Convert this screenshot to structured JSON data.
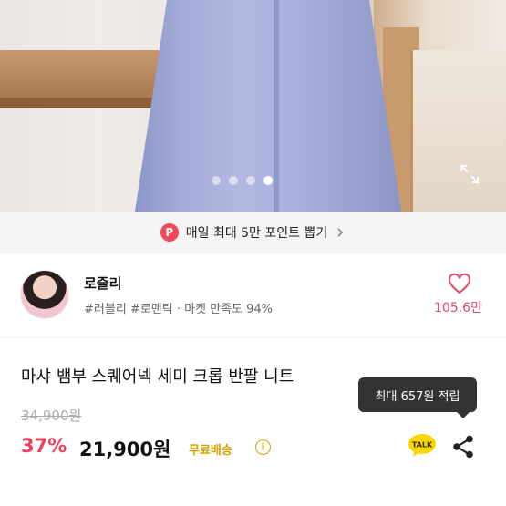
{
  "gallery": {
    "dots": [
      false,
      false,
      false,
      true
    ],
    "expand_icon": "expand-icon"
  },
  "banner": {
    "badge": "P",
    "text": "매일 최대 5만 포인트 뽑기",
    "chevron_icon": "chevron-right-icon"
  },
  "seller": {
    "name": "로즐리",
    "tags": "#러블리 #로맨틱 · 마켓 만족도 94%",
    "likes": "105.6만",
    "heart_icon": "heart-icon"
  },
  "product": {
    "title": "마샤 뱀부 스퀘어넥 세미 크롭 반팔 니트",
    "original_price": "34,900원",
    "discount": "37%",
    "price": "21,900원",
    "shipping": "무료배송",
    "info_symbol": "i"
  },
  "tooltip": {
    "text": "최대 657원 적립"
  },
  "actions": {
    "talk_label": "TALK",
    "share_icon": "share-icon"
  },
  "colors": {
    "accent_pink": "#e9425e",
    "shipping_yellow": "#d4a100",
    "talk_yellow": "#f7d700"
  }
}
